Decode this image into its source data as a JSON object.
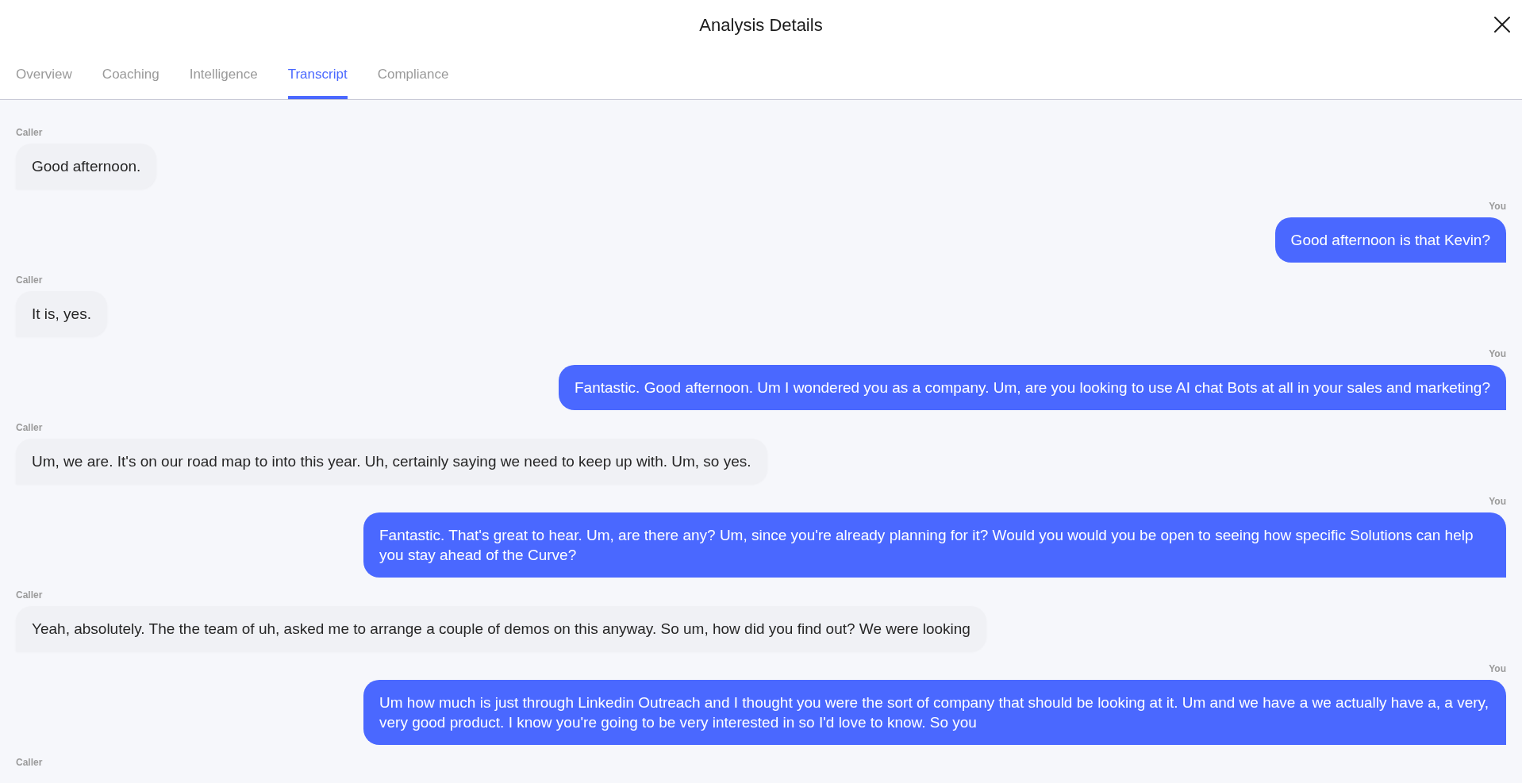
{
  "window": {
    "title": "Analysis Details"
  },
  "tabs": [
    {
      "label": "Overview",
      "selected": false
    },
    {
      "label": "Coaching",
      "selected": false
    },
    {
      "label": "Intelligence",
      "selected": false
    },
    {
      "label": "Transcript",
      "selected": true
    },
    {
      "label": "Compliance",
      "selected": false
    }
  ],
  "transcript": [
    {
      "kind": "caller",
      "speaker": "Caller",
      "text": "Good afternoon."
    },
    {
      "kind": "you",
      "speaker": "You",
      "text": "Good afternoon is that Kevin?"
    },
    {
      "kind": "caller",
      "speaker": "Caller",
      "text": "It is, yes."
    },
    {
      "kind": "you",
      "speaker": "You",
      "text": "Fantastic. Good afternoon. Um I wondered you as a company. Um, are you looking to use AI chat Bots at all in your sales and marketing?"
    },
    {
      "kind": "caller",
      "speaker": "Caller",
      "text": "Um, we are. It's on our road map to into this year. Uh, certainly saying we need to keep up with. Um, so yes."
    },
    {
      "kind": "you",
      "speaker": "You",
      "text": "Fantastic. That's great to hear. Um, are there any? Um, since you're already planning for it? Would you would you be open to seeing how specific Solutions can help you stay ahead of the Curve?"
    },
    {
      "kind": "caller",
      "speaker": "Caller",
      "text": "Yeah, absolutely. The the team of uh, asked me to arrange a couple of demos on this anyway. So um, how did you find out? We were looking"
    },
    {
      "kind": "you",
      "speaker": "You",
      "text": "Um how much is just through Linkedin Outreach and I thought you were the sort of company that should be looking at it. Um and we have a we actually have a, a very, very good product. I know you're going to be very interested in so I'd love to know. So you"
    },
    {
      "kind": "caller",
      "speaker": "Caller"
    }
  ]
}
